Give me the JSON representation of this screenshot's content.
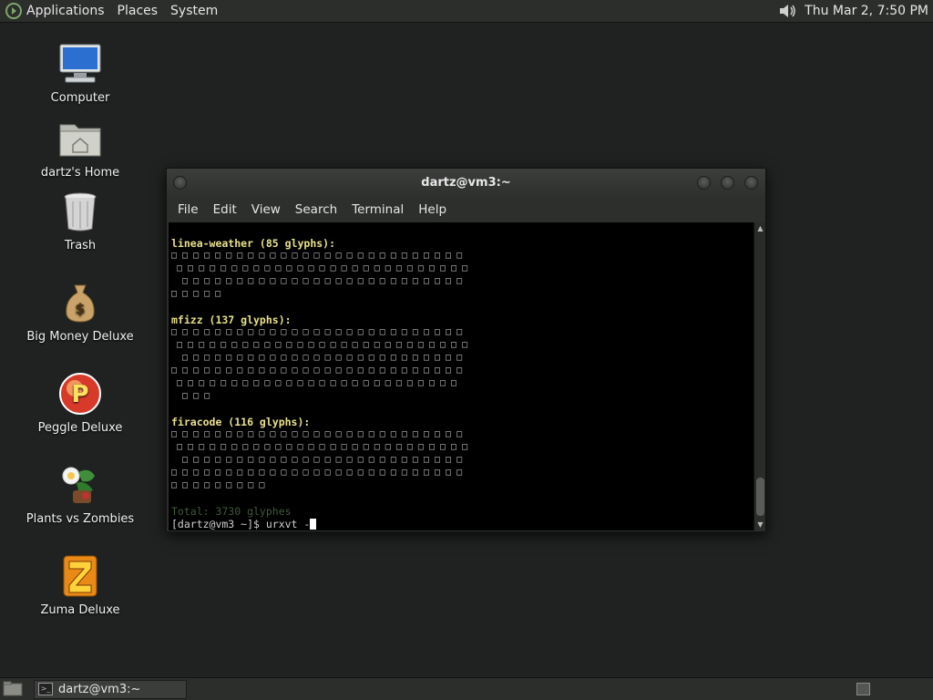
{
  "top_panel": {
    "menus": [
      "Applications",
      "Places",
      "System"
    ],
    "clock": "Thu Mar  2,  7:50 PM"
  },
  "desktop": {
    "icons": [
      {
        "label": "Computer",
        "icon": "computer-icon"
      },
      {
        "label": "dartz's Home",
        "icon": "home-folder-icon"
      },
      {
        "label": "Trash",
        "icon": "trash-icon"
      },
      {
        "label": "Big Money Deluxe",
        "icon": "money-bag-icon"
      },
      {
        "label": "Peggle Deluxe",
        "icon": "peggle-icon"
      },
      {
        "label": "Plants vs Zombies",
        "icon": "plants-vs-zombies-icon"
      },
      {
        "label": "Zuma Deluxe",
        "icon": "zuma-icon"
      }
    ]
  },
  "window": {
    "title": "dartz@vm3:~",
    "menu": [
      "File",
      "Edit",
      "View",
      "Search",
      "Terminal",
      "Help"
    ]
  },
  "terminal": {
    "sections": [
      {
        "header": "linea-weather (85 glyphs):",
        "rows": [
          "□ □ □ □ □ □ □ □ □ □ □ □ □ □ □ □ □ □ □ □ □ □ □ □ □ □ □",
          " □ □ □ □ □ □ □ □ □ □ □ □ □ □ □ □ □ □ □ □ □ □ □ □ □ □ □",
          "  □ □ □ □ □ □ □ □ □ □ □ □ □ □ □ □ □ □ □ □ □ □ □ □ □ □",
          "□ □ □ □ □"
        ]
      },
      {
        "header": "mfizz (137 glyphs):",
        "rows": [
          "□ □ □ □ □ □ □ □ □ □ □ □ □ □ □ □ □ □ □ □ □ □ □ □ □ □ □",
          " □ □ □ □ □ □ □ □ □ □ □ □ □ □ □ □ □ □ □ □ □ □ □ □ □ □ □",
          "  □ □ □ □ □ □ □ □ □ □ □ □ □ □ □ □ □ □ □ □ □ □ □ □ □ □",
          "□ □ □ □ □ □ □ □ □ □ □ □ □ □ □ □ □ □ □ □ □ □ □ □ □ □ □",
          " □ □ □ □ □ □ □ □ □ □ □ □ □ □ □ □ □ □ □ □ □ □ □ □ □ □",
          "  □ □ □"
        ]
      },
      {
        "header": "firacode (116 glyphs):",
        "rows": [
          "□ □ □ □ □ □ □ □ □ □ □ □ □ □ □ □ □ □ □ □ □ □ □ □ □ □ □",
          " □ □ □ □ □ □ □ □ □ □ □ □ □ □ □ □ □ □ □ □ □ □ □ □ □ □ □",
          "  □ □ □ □ □ □ □ □ □ □ □ □ □ □ □ □ □ □ □ □ □ □ □ □ □ □",
          "□ □ □ □ □ □ □ □ □ □ □ □ □ □ □ □ □ □ □ □ □ □ □ □ □ □ □",
          "□ □ □ □ □ □ □ □ □"
        ]
      }
    ],
    "total": "Total: 3730 glyphes",
    "prompt": "[dartz@vm3 ~]$ urxvt -"
  },
  "bottom_panel": {
    "task_label": "dartz@vm3:~"
  }
}
